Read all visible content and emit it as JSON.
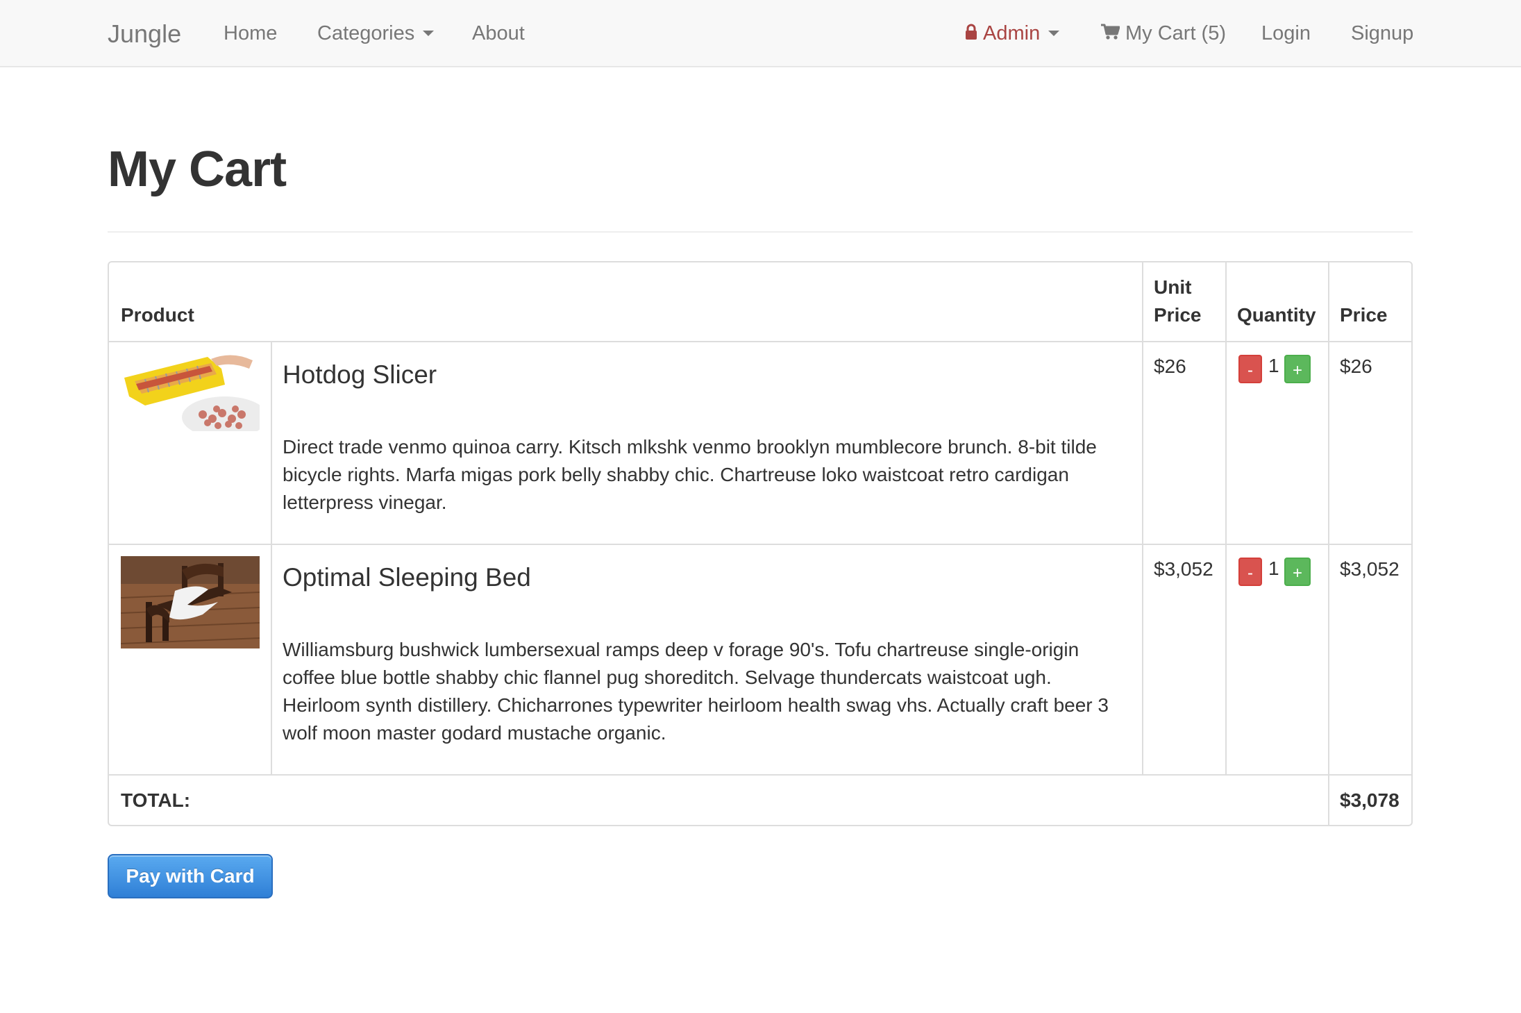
{
  "navbar": {
    "brand": "Jungle",
    "links": {
      "home": "Home",
      "categories": "Categories",
      "about": "About",
      "admin": "Admin",
      "cart": "My Cart (5)",
      "login": "Login",
      "signup": "Signup"
    },
    "admin_color": "#a94442"
  },
  "page": {
    "title": "My Cart"
  },
  "table": {
    "headers": {
      "product": "Product",
      "unit_price_line1": "Unit",
      "unit_price_line2": "Price",
      "quantity": "Quantity",
      "price": "Price"
    },
    "items": [
      {
        "name": "Hotdog Slicer",
        "description": "Direct trade venmo quinoa carry. Kitsch mlkshk venmo brooklyn mumblecore brunch. 8-bit tilde bicycle rights. Marfa migas pork belly shabby chic. Chartreuse loko waistcoat retro cardigan letterpress vinegar.",
        "unit_price": "$26",
        "quantity": "1",
        "price": "$26",
        "decrement_label": "-",
        "increment_label": "+"
      },
      {
        "name": "Optimal Sleeping Bed",
        "description": "Williamsburg bushwick lumbersexual ramps deep v forage 90's. Tofu chartreuse single-origin coffee blue bottle shabby chic flannel pug shoreditch. Selvage thundercats waistcoat ugh. Heirloom synth distillery. Chicharrones typewriter heirloom health swag vhs. Actually craft beer 3 wolf moon master godard mustache organic.",
        "unit_price": "$3,052",
        "quantity": "1",
        "price": "$3,052",
        "decrement_label": "-",
        "increment_label": "+"
      }
    ],
    "total_label": "TOTAL:",
    "total_value": "$3,078"
  },
  "checkout": {
    "pay_label": "Pay with Card"
  },
  "colors": {
    "minus_button": "#d9534f",
    "plus_button": "#5cb85c",
    "pay_button": "#3a8ee6"
  }
}
